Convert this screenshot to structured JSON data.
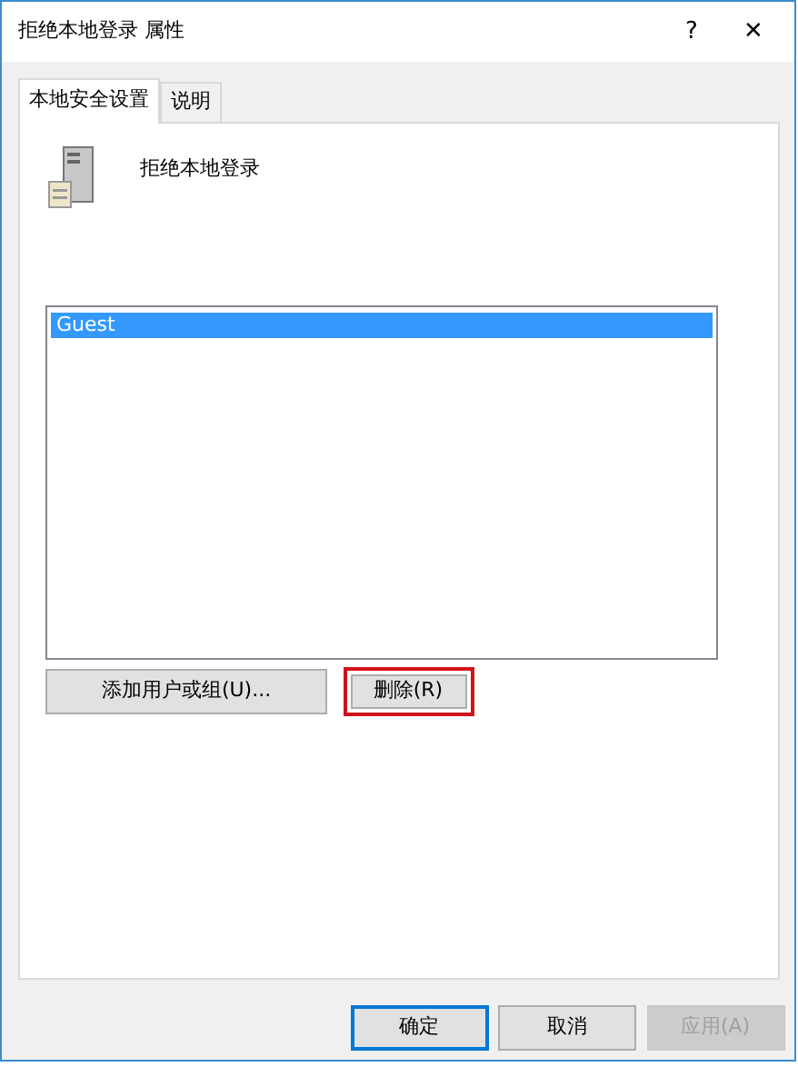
{
  "window": {
    "title": "拒绝本地登录 属性",
    "help": "?",
    "close": "✕"
  },
  "tabs": [
    {
      "label": "本地安全设置",
      "selected": true
    },
    {
      "label": "说明",
      "selected": false
    }
  ],
  "policy": {
    "name": "拒绝本地登录"
  },
  "members": [
    {
      "name": "Guest",
      "selected": true
    }
  ],
  "actions": [
    {
      "label": "添加用户或组(U)...",
      "highlighted": false
    },
    {
      "label": "删除(R)",
      "highlighted": true
    }
  ],
  "buttons": [
    {
      "label": "确定",
      "default": true,
      "disabled": false
    },
    {
      "label": "取消",
      "default": false,
      "disabled": false
    },
    {
      "label": "应用(A)",
      "default": false,
      "disabled": true
    }
  ]
}
